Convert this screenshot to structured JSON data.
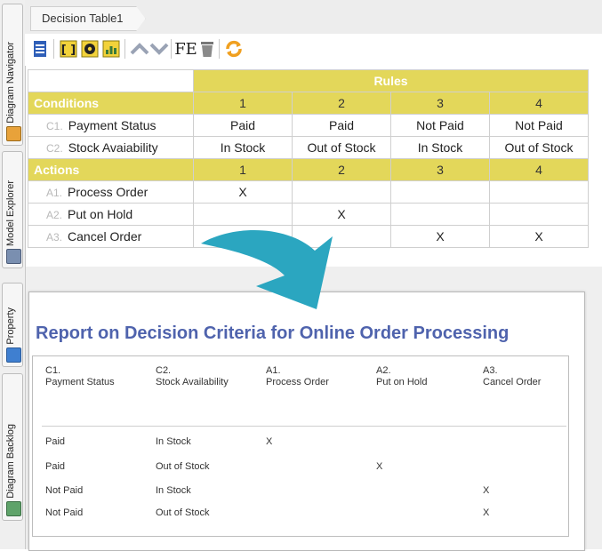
{
  "sidebar": {
    "tabs": [
      {
        "label": "Diagram Navigator",
        "icon": "navigator-icon"
      },
      {
        "label": "Model Explorer",
        "icon": "explorer-icon"
      },
      {
        "label": "Property",
        "icon": "property-icon"
      },
      {
        "label": "Diagram Backlog",
        "icon": "backlog-icon"
      }
    ]
  },
  "tab": {
    "title": "Decision Table1"
  },
  "toolbar": {
    "icons": [
      "table-icon",
      "bracket-icon",
      "gear-icon",
      "chart-icon",
      "move-up-icon",
      "move-down-icon",
      "fe-icon",
      "delete-icon",
      "refresh-icon"
    ],
    "fe_label": "FE"
  },
  "decision_table": {
    "rules_header": "Rules",
    "conditions_header": "Conditions",
    "actions_header": "Actions",
    "rule_numbers": [
      "1",
      "2",
      "3",
      "4"
    ],
    "conditions": [
      {
        "prefix": "C1.",
        "label": "Payment Status",
        "values": [
          "Paid",
          "Paid",
          "Not Paid",
          "Not Paid"
        ]
      },
      {
        "prefix": "C2.",
        "label": "Stock Avaiability",
        "values": [
          "In Stock",
          "Out of Stock",
          "In Stock",
          "Out of Stock"
        ]
      }
    ],
    "actions": [
      {
        "prefix": "A1.",
        "label": "Process Order",
        "values": [
          "X",
          "",
          "",
          ""
        ]
      },
      {
        "prefix": "A2.",
        "label": "Put on Hold",
        "values": [
          "",
          "X",
          "",
          ""
        ]
      },
      {
        "prefix": "A3.",
        "label": "Cancel Order",
        "values": [
          "",
          "",
          "X",
          "X"
        ]
      }
    ]
  },
  "report": {
    "title": "Report on Decision Criteria for Online Order Processing",
    "headers": [
      {
        "code": "C1.",
        "name": "Payment Status"
      },
      {
        "code": "C2.",
        "name": "Stock Availability"
      },
      {
        "code": "A1.",
        "name": "Process Order"
      },
      {
        "code": "A2.",
        "name": "Put on Hold"
      },
      {
        "code": "A3.",
        "name": "Cancel Order"
      }
    ],
    "rows": [
      [
        "Paid",
        "In Stock",
        "X",
        "",
        ""
      ],
      [
        "Paid",
        "Out of Stock",
        "",
        "X",
        ""
      ],
      [
        "Not Paid",
        "In Stock",
        "",
        "",
        "X"
      ],
      [
        "Not Paid",
        "Out of Stock",
        "",
        "",
        "X"
      ]
    ]
  },
  "colors": {
    "accent_yellow": "#e3d75a",
    "title_blue": "#4f63ad",
    "arrow_teal": "#2ba6c0"
  }
}
